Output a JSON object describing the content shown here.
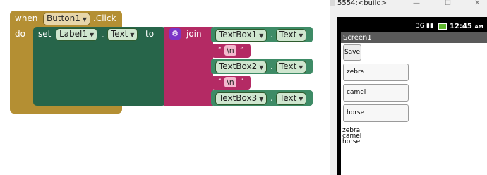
{
  "blocks": {
    "event_when": "when",
    "event_component": "Button1",
    "event_name": ".Click",
    "event_do": "do",
    "set_keyword": "set",
    "set_component": "Label1",
    "set_dot": ".",
    "set_property": "Text",
    "set_to": "to",
    "join_label": "join",
    "join_items": [
      {
        "component": "TextBox1",
        "dot": ".",
        "property": "Text"
      },
      {
        "string": "\\n"
      },
      {
        "component": "TextBox2",
        "dot": ".",
        "property": "Text"
      },
      {
        "string": "\\n"
      },
      {
        "component": "TextBox3",
        "dot": ".",
        "property": "Text"
      }
    ]
  },
  "emulator": {
    "window_title": "5554:<build>",
    "clock": "12:45",
    "clock_suffix": "AM",
    "screen_title": "Screen1",
    "save_button": "Save",
    "textboxes": [
      "zebra",
      "camel",
      "horse"
    ],
    "label_text": "zebra\ncamel\nhorse",
    "colors": {
      "event_block": "#b48f33",
      "set_block": "#27654a",
      "join_block": "#b42a64",
      "component_block": "#3e8b66",
      "title_bar": "#5a5a5a"
    }
  }
}
